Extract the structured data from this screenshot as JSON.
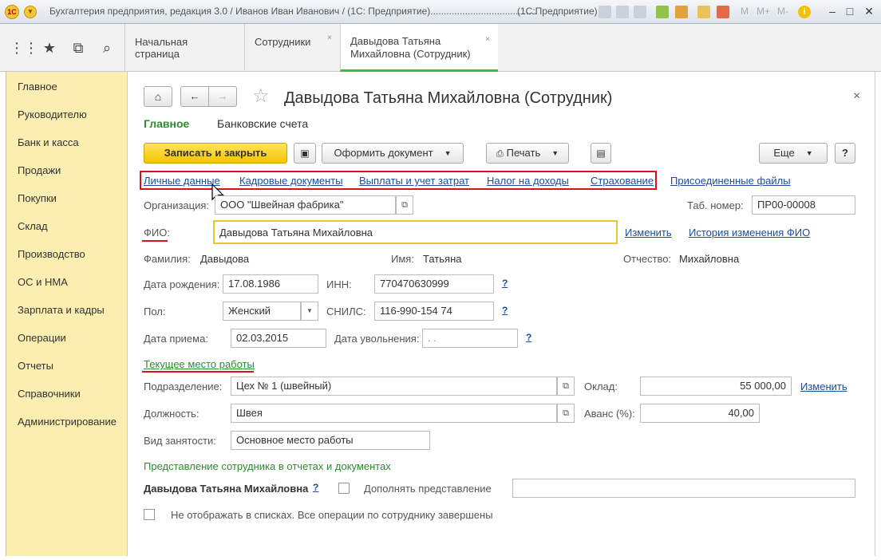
{
  "titlebar": {
    "logo": "1С",
    "title": "Бухгалтерия предприятия, редакция 3.0 / Иванов Иван Иванович / (1С: Предприятие)........................................",
    "app_name": "(1С:Предприятие)",
    "m_labels": [
      "M",
      "M+",
      "M-"
    ],
    "info_icon": "info-icon"
  },
  "nav": {
    "icons": [
      "apps-grid-icon",
      "star-icon",
      "history-icon",
      "search-icon"
    ]
  },
  "tabs": [
    {
      "label": "Начальная страница"
    },
    {
      "label": "Сотрудники",
      "close": "×"
    },
    {
      "label_line1": "Давыдова Татьяна",
      "label_line2": "Михайловна (Сотрудник)",
      "close": "×"
    }
  ],
  "sidebar": {
    "items": [
      "Главное",
      "Руководителю",
      "Банк и касса",
      "Продажи",
      "Покупки",
      "Склад",
      "Производство",
      "ОС и НМА",
      "Зарплата и кадры",
      "Операции",
      "Отчеты",
      "Справочники",
      "Администрирование"
    ]
  },
  "form": {
    "title": "Давыдова Татьяна Михайловна (Сотрудник)",
    "close": "×",
    "subtabs": [
      "Главное",
      "Банковские счета"
    ],
    "toolbar": {
      "save_close": "Записать и закрыть",
      "make_doc": "Оформить документ",
      "print": "Печать",
      "more": "Еще",
      "help": "?"
    },
    "links": [
      "Личные данные",
      "Кадровые документы",
      "Выплаты и учет затрат",
      "Налог на доходы",
      "Страхование",
      "Присоединенные файлы"
    ],
    "org_label": "Организация:",
    "org_value": "ООО \"Швейная фабрика\"",
    "tab_num_label": "Таб. номер:",
    "tab_num_value": "ПР00-00008",
    "fio_label": "ФИО:",
    "fio_value": "Давыдова Татьяна Михайловна",
    "fio_change": "Изменить",
    "fio_history": "История изменения ФИО",
    "surname_label": "Фамилия:",
    "surname_value": "Давыдова",
    "name_label": "Имя:",
    "name_value": "Татьяна",
    "patronymic_label": "Отчество:",
    "patronymic_value": "Михайловна",
    "birth_label": "Дата рождения:",
    "birth_value": "17.08.1986",
    "inn_label": "ИНН:",
    "inn_value": "770470630999",
    "gender_label": "Пол:",
    "gender_value": "Женский",
    "snils_label": "СНИЛС:",
    "snils_value": "116-990-154 74",
    "hire_label": "Дата приема:",
    "hire_value": "02.03.2015",
    "fire_label": "Дата увольнения:",
    "fire_value": " .  .",
    "qmark": "?",
    "workplace_link": "Текущее место работы",
    "dept_label": "Подразделение:",
    "dept_value": "Цех № 1 (швейный)",
    "salary_label": "Оклад:",
    "salary_value": "55 000,00",
    "salary_change": "Изменить",
    "position_label": "Должность:",
    "position_value": "Швея",
    "advance_label": "Аванс (%):",
    "advance_value": "40,00",
    "employment_label": "Вид занятости:",
    "employment_value": "Основное место работы",
    "presentation_header": "Представление сотрудника в отчетах и документах",
    "presentation_name": "Давыдова Татьяна Михайловна",
    "supplement_label": "Дополнять представление",
    "hide_label": "Не отображать в списках. Все операции по сотруднику завершены"
  },
  "colors": {
    "sidebar_bg": "#fbeeb0",
    "accent_green": "#2e8b2e",
    "link_blue": "#1a4d9c",
    "highlight_red": "#d9131c",
    "save_button": "#f5c400"
  }
}
